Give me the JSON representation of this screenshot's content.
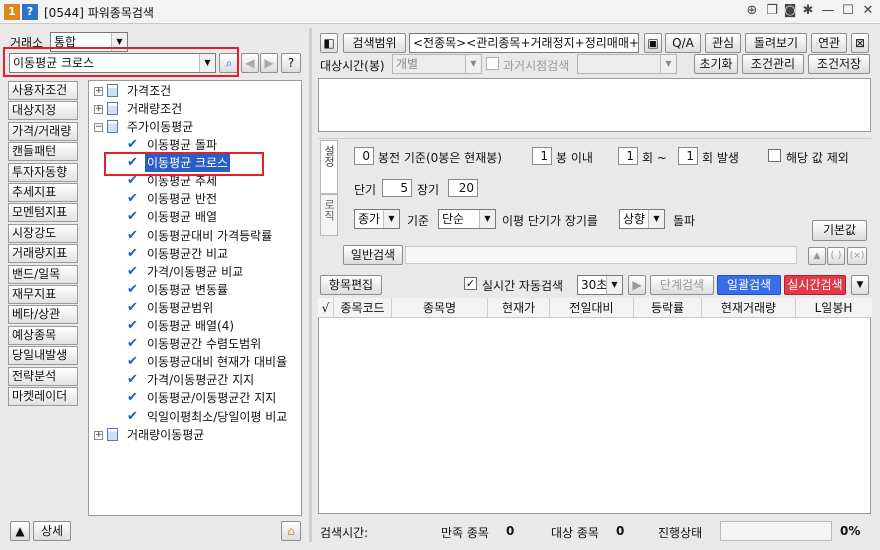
{
  "window": {
    "id_badge": "1",
    "help_badge": "?",
    "title": "[0544] 파워종목검색"
  },
  "left": {
    "exchange_label": "거래소",
    "exchange_value": "통합",
    "search_value": "이동평균 크로스",
    "help_btn": "?",
    "categories": [
      "사용자조건",
      "대상지정",
      "가격/거래량",
      "캔들패턴",
      "투자자동향",
      "추세지표",
      "모멘텀지표",
      "시장강도",
      "거래량지표",
      "밴드/일목",
      "재무지표",
      "베타/상관",
      "예상종목",
      "당일내발생",
      "전략분석",
      "마켓레이더"
    ],
    "detail_btn": "상세"
  },
  "tree": {
    "groups": {
      "price": "가격조건",
      "volume": "거래량조건",
      "ma": "주가이동평균",
      "volume_ma": "거래량이동평균"
    },
    "items": [
      "이동평균 돌파",
      "이동평균 크로스",
      "이동평균 추세",
      "이동평균 반전",
      "이동평균 배열",
      "이동평균대비 가격등락률",
      "이동평균간 비교",
      "가격/이동평균 비교",
      "이동평균 변동률",
      "이동평균범위",
      "이동평균 배열(4)",
      "이동평균간 수렴도범위",
      "이동평균대비 현재가 대비율",
      "가격/이동평균간 지지",
      "이동평균/이동평균간 지지",
      "익일이평최소/당일이평 비교"
    ]
  },
  "toolbar": {
    "search_range_btn": "검색범위",
    "range_text": "<전종목><관리종목+거래정지+정리매매+ET",
    "qa_btn": "Q/A",
    "interest_btn": "관심",
    "review_btn": "돌려보기",
    "link_btn": "연관",
    "target_time_label": "대상시간(봉)",
    "target_time_value": "개별",
    "past_search_label": "과거시점검색",
    "reset_btn": "초기화",
    "manage_btn": "조건관리",
    "save_btn": "조건저장"
  },
  "settings": {
    "tab_setting": "설정",
    "tab_logic": "로직",
    "n1": "0",
    "t1": "봉전 기준(0봉은 현재봉)",
    "n2": "1",
    "t2": "봉 이내",
    "n3": "1",
    "t3": "회 ~",
    "n4": "1",
    "t4": "회 발생",
    "exclude_label": "해당 값 제외",
    "short_label": "단기",
    "short_value": "5",
    "long_label": "장기",
    "long_value": "20",
    "price_type": "종가",
    "basis_label": "기준",
    "ma_type": "단순",
    "desc1": "이평 단기가 장기를",
    "direction": "상향",
    "desc2": "돌파",
    "default_btn": "기본값",
    "normal_search_tab": "일반검색"
  },
  "results": {
    "edit_btn": "항목편집",
    "realtime_label": "실시간 자동검색",
    "interval": "30초",
    "step_btn": "단계검색",
    "batch_btn": "일괄검색",
    "realtime_btn": "실시간검색",
    "columns": [
      "√",
      "종목코드",
      "종목명",
      "현재가",
      "전일대비",
      "등락률",
      "현재거래량",
      "L일봉H"
    ]
  },
  "status": {
    "time_label": "검색시간:",
    "match_label": "만족 종목",
    "match_count": "0",
    "target_label": "대상 종목",
    "target_count": "0",
    "progress_label": "진행상태",
    "progress_pct": "0%"
  },
  "colors": {
    "batch_btn": "#3a6ee8",
    "realtime_btn": "#e23a4a",
    "highlight": "#e0202a",
    "selection": "#2a5fc9"
  }
}
